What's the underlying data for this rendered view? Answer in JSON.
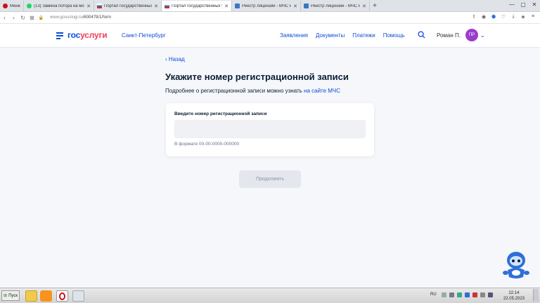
{
  "browser": {
    "tabs": [
      {
        "label": "Меню",
        "active": false,
        "icon": "opera-icon",
        "color": "#cc0f16"
      },
      {
        "label": "(13) Замена потора на мо",
        "active": false,
        "icon": "whatsapp-icon",
        "color": "#25d366"
      },
      {
        "label": "Портал государственных у",
        "active": false,
        "icon": "gosuslugi-icon",
        "color": "#2e6fd6"
      },
      {
        "label": "Портал государственных у",
        "active": true,
        "icon": "gosuslugi-icon",
        "color": "#2e6fd6"
      },
      {
        "label": "Реестр лицензий - МЧС Росс",
        "active": false,
        "icon": "mchs-icon",
        "color": "#3a78c2"
      },
      {
        "label": "Реестр лицензий - МЧС Росс",
        "active": false,
        "icon": "mchs-icon",
        "color": "#3a78c2"
      }
    ],
    "new_tab": "+",
    "url_host": "www.gosuslugi.ru",
    "url_path": "/600479/1/form"
  },
  "site": {
    "logo_blue": "гос",
    "logo_red": "услуги",
    "region": "Санкт-Петербург",
    "nav": [
      "Заявления",
      "Документы",
      "Платежи",
      "Помощь"
    ],
    "user_name": "Роман П.",
    "avatar_initials": "ПР"
  },
  "main": {
    "back": "Назад",
    "title": "Укажите номер регистрационной записи",
    "subtitle_text": "Подробнее о регистрационной записи можно узнать ",
    "subtitle_link": "на сайте МЧС",
    "field_label": "Введите номер регистрационной записи",
    "field_value": "",
    "field_hint": "В формате 00-00-0000-000000",
    "continue_button": "Продолжить"
  },
  "taskbar": {
    "start": "Пуск",
    "lang": "RU",
    "time": "22:14",
    "date": "22.05.2023"
  },
  "colors": {
    "accent": "#0d4cd3",
    "logo_red": "#ee3f58",
    "avatar": "#9b3dcc",
    "disabled_button": "#e5e7ee"
  }
}
